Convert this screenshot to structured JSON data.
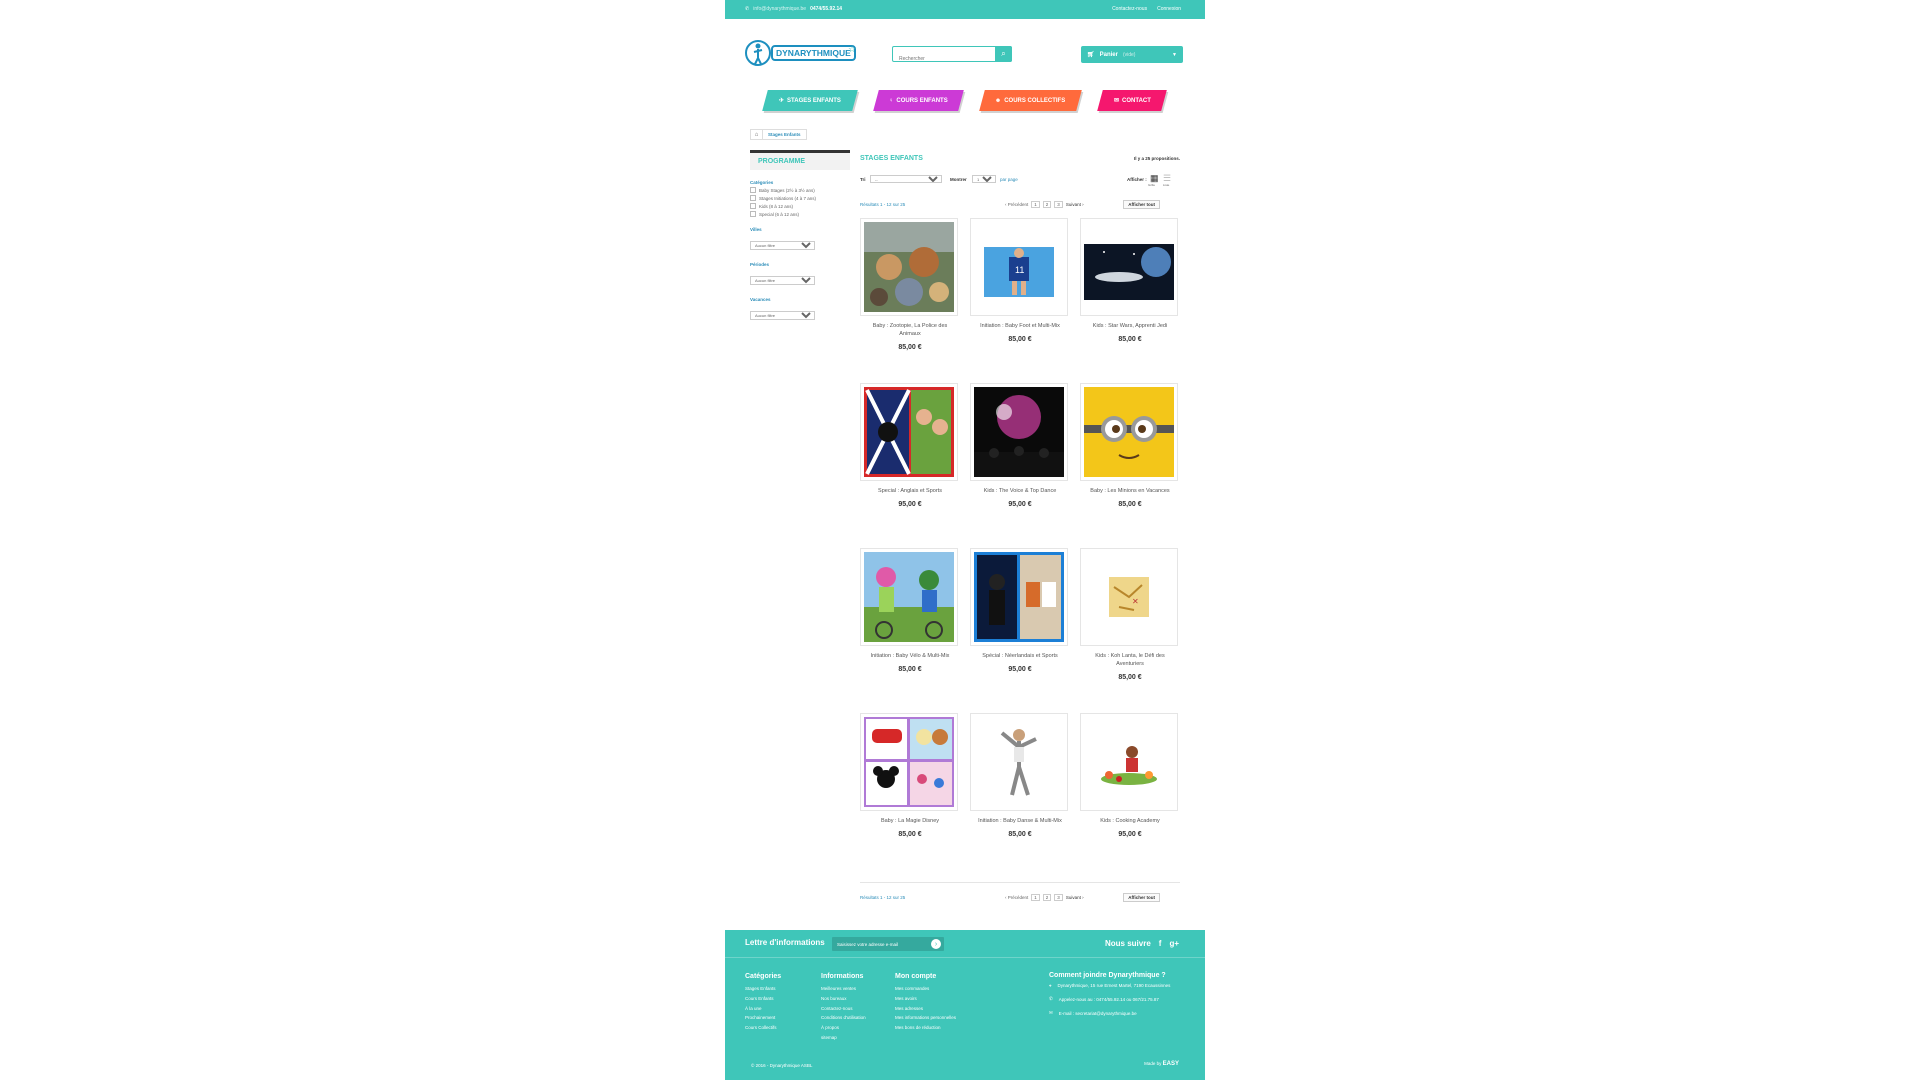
{
  "colors": {
    "accent": "#3fc6b9",
    "link": "#2a8cb8",
    "nav": [
      "#3fc6b9",
      "#cc3ad6",
      "#ff6a3c",
      "#f5176e"
    ]
  },
  "topbar": {
    "email": "info@dynarythmique.be",
    "phone": "0474/55.92.14",
    "links": [
      "Contactez-nous",
      "Connexion"
    ]
  },
  "logo": {
    "text": "DYNARYTHMIQUE"
  },
  "search": {
    "placeholder": "Rechercher"
  },
  "cart": {
    "label": "Panier",
    "status": "(vide)"
  },
  "nav": [
    {
      "label": "STAGES ENFANTS",
      "icon": "plane-icon"
    },
    {
      "label": "COURS ENFANTS",
      "icon": "person-icon"
    },
    {
      "label": "COURS COLLECTIFS",
      "icon": "group-icon"
    },
    {
      "label": "CONTACT",
      "icon": "mail-icon"
    }
  ],
  "breadcrumb": {
    "current": "Stages Enfants"
  },
  "sidebar": {
    "title": "PROGRAMME",
    "cat_label": "Catégories",
    "categories": [
      "Baby Stages (2½ à 3½ ans)",
      "Stages Initiations (4 à 7 ans)",
      "Kids (8 à 12 ans)",
      "Special (6 à 12 ans)"
    ],
    "ville_label": "Villes",
    "periode_label": "Périodes",
    "vacances_label": "Vacances",
    "select_default": "Aucun filtre"
  },
  "main": {
    "title": "STAGES ENFANTS",
    "count": "Il y a 25 propositions.",
    "sort_label": "Tri",
    "sort_value": "--",
    "show_label": "Montrer",
    "show_value": "12",
    "per_page": "par page",
    "view_label": "Afficher :",
    "view_grid": "Grille",
    "view_list": "Liste",
    "results": "Résultats 1 - 12 sur 25",
    "prev": "‹ Précédent",
    "pages": [
      "1",
      "2",
      "3"
    ],
    "next": "Suivant ›",
    "show_all": "Afficher tout"
  },
  "products": [
    {
      "name": "Baby : Zootopie, La Police des Animaux",
      "price": "85,00 €",
      "img": "zootopia"
    },
    {
      "name": "Initiation : Baby Foot et Multi-Mix",
      "price": "85,00 €",
      "img": "football"
    },
    {
      "name": "Kids : Star Wars, Apprenti Jedi",
      "price": "85,00 €",
      "img": "space"
    },
    {
      "name": "Special : Anglais et Sports",
      "price": "95,00 €",
      "img": "english"
    },
    {
      "name": "Kids : The Voice & Top Dance",
      "price": "95,00 €",
      "img": "concert"
    },
    {
      "name": "Baby : Les Minions en Vacances",
      "price": "85,00 €",
      "img": "minion"
    },
    {
      "name": "Initiation : Baby Vélo & Multi-Mix",
      "price": "85,00 €",
      "img": "bike"
    },
    {
      "name": "Spécial : Néerlandais et Sports",
      "price": "95,00 €",
      "img": "dutch"
    },
    {
      "name": "Kids : Koh Lanta, le Défi des Aventuriers",
      "price": "85,00 €",
      "img": "map"
    },
    {
      "name": "Baby : La Magie Disney",
      "price": "85,00 €",
      "img": "disney"
    },
    {
      "name": "Initiation : Baby Danse & Multi-Mix",
      "price": "85,00 €",
      "img": "dance"
    },
    {
      "name": "Kids : Cooking Academy",
      "price": "95,00 €",
      "img": "cooking"
    }
  ],
  "footer": {
    "newsletter": "Lettre d'informations",
    "newsletter_placeholder": "Saisissez votre adresse e-mail",
    "follow": "Nous suivre",
    "cols": [
      {
        "title": "Catégories",
        "links": [
          "Stages Enfants",
          "Cours Enfants",
          "À la une",
          "Prochainement",
          "Cours Collectifs"
        ]
      },
      {
        "title": "Informations",
        "links": [
          "Meilleures ventes",
          "Nos bureaux",
          "Contactez-nous",
          "Conditions d'utilisation",
          "À propos",
          "sitemap"
        ]
      },
      {
        "title": "Mon compte",
        "links": [
          "Mes commandes",
          "Mes avoirs",
          "Mes adresses",
          "Mes informations personnelles",
          "Mes bons de réduction"
        ]
      }
    ],
    "contact_title": "Comment joindre Dynarythmique ?",
    "address": "Dynarythmique, 15 rue Ernest Martel, 7190 Ecaussinnes",
    "phone": "Appelez-nous au : 0474/55.92.14 ou 067/21.75.87",
    "email": "E-mail : secretariat@dynarythmique.be",
    "copyright": "© 2016 - Dynarythmique ASBL",
    "made_by": "Made by",
    "made_brand": "EASY"
  }
}
